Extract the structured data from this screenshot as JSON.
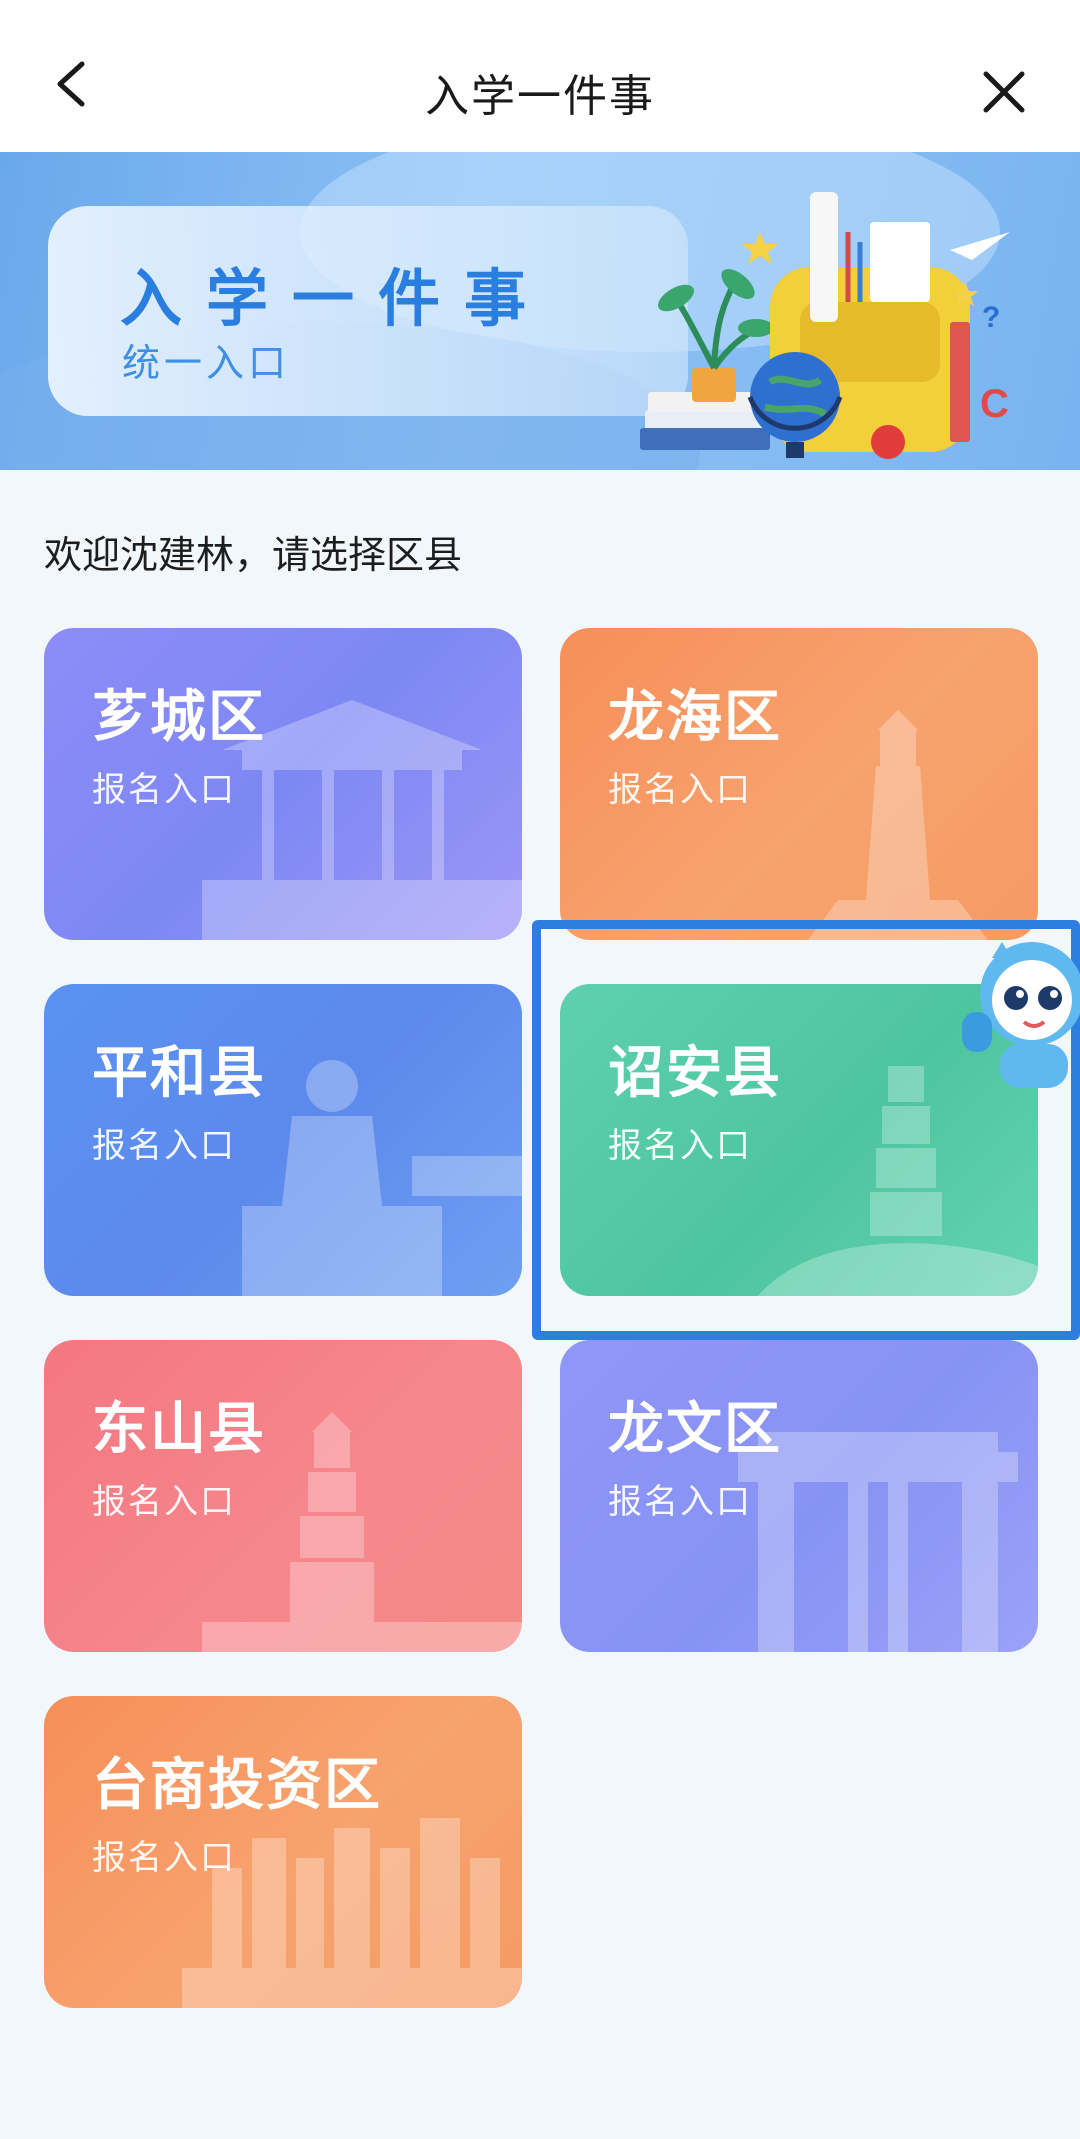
{
  "header": {
    "title": "入学一件事",
    "back_icon": "chevron-left-icon",
    "close_icon": "close-icon"
  },
  "banner": {
    "title": "入学一件事",
    "subtitle": "统一入口"
  },
  "welcome": "欢迎沈建林，请选择区县",
  "districts": [
    {
      "name": "芗城区",
      "entry": "报名入口",
      "color": "#8d8cf8"
    },
    {
      "name": "龙海区",
      "entry": "报名入口",
      "color": "#f78e58"
    },
    {
      "name": "平和县",
      "entry": "报名入口",
      "color": "#5a93f2"
    },
    {
      "name": "诏安县",
      "entry": "报名入口",
      "color": "#5ed0ad"
    },
    {
      "name": "东山县",
      "entry": "报名入口",
      "color": "#f47781"
    },
    {
      "name": "龙文区",
      "entry": "报名入口",
      "color": "#8f96f8"
    },
    {
      "name": "台商投资区",
      "entry": "报名入口",
      "color": "#f78e58"
    }
  ],
  "colors": {
    "accent": "#2e7ee0",
    "background": "#f2f7fc"
  }
}
